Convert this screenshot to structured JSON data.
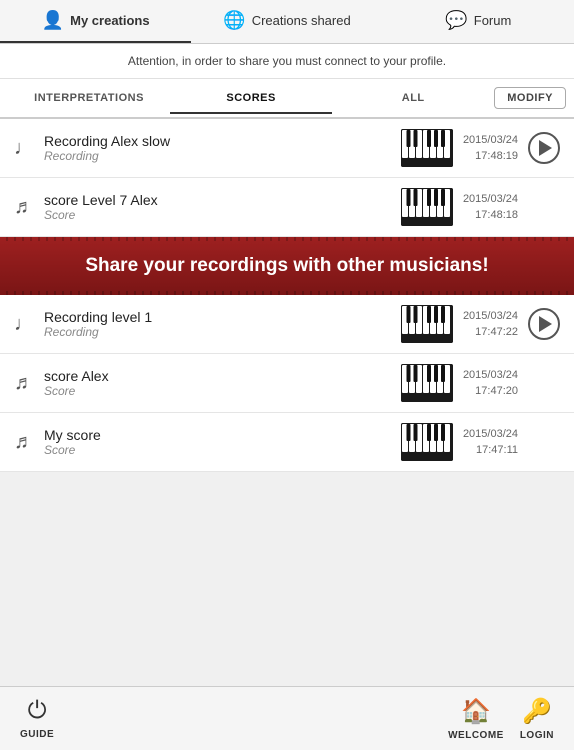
{
  "nav": {
    "tabs": [
      {
        "id": "my-creations",
        "label": "My creations",
        "icon": "👤",
        "active": true
      },
      {
        "id": "creations-shared",
        "label": "Creations shared",
        "icon": "🌐",
        "active": false
      },
      {
        "id": "forum",
        "label": "Forum",
        "icon": "💬",
        "active": false
      }
    ]
  },
  "attention": {
    "text": "Attention, in order to share you must connect to your profile."
  },
  "filters": {
    "tabs": [
      {
        "id": "interpretations",
        "label": "INTERPRETATIONS",
        "active": false
      },
      {
        "id": "scores",
        "label": "SCORES",
        "active": false
      },
      {
        "id": "all",
        "label": "ALL",
        "active": true
      }
    ],
    "modify_label": "MODIFY"
  },
  "items": [
    {
      "id": 1,
      "type_icon": "♩",
      "title": "Recording Alex slow",
      "subtitle": "Recording",
      "date": "2015/03/24",
      "time": "17:48:19",
      "has_play": true
    },
    {
      "id": 2,
      "type_icon": "𝄢",
      "title": "score Level 7 Alex",
      "subtitle": "Score",
      "date": "2015/03/24",
      "time": "17:48:18",
      "has_play": false
    },
    {
      "id": 3,
      "type_icon": "♩",
      "title": "Recording level 1",
      "subtitle": "Recording",
      "date": "2015/03/24",
      "time": "17:47:22",
      "has_play": true
    },
    {
      "id": 4,
      "type_icon": "𝄢",
      "title": "score Alex",
      "subtitle": "Score",
      "date": "2015/03/24",
      "time": "17:47:20",
      "has_play": false
    },
    {
      "id": 5,
      "type_icon": "𝄢",
      "title": "My score",
      "subtitle": "Score",
      "date": "2015/03/24",
      "time": "17:47:11",
      "has_play": false
    }
  ],
  "promo": {
    "text": "Share your recordings with other musicians!"
  },
  "bottom_nav": {
    "buttons": [
      {
        "id": "guide",
        "label": "GUIDE",
        "icon": "⏻"
      },
      {
        "id": "welcome",
        "label": "WELCOME",
        "icon": "🏠"
      },
      {
        "id": "login",
        "label": "LOGIN",
        "icon": "🔑"
      }
    ]
  }
}
